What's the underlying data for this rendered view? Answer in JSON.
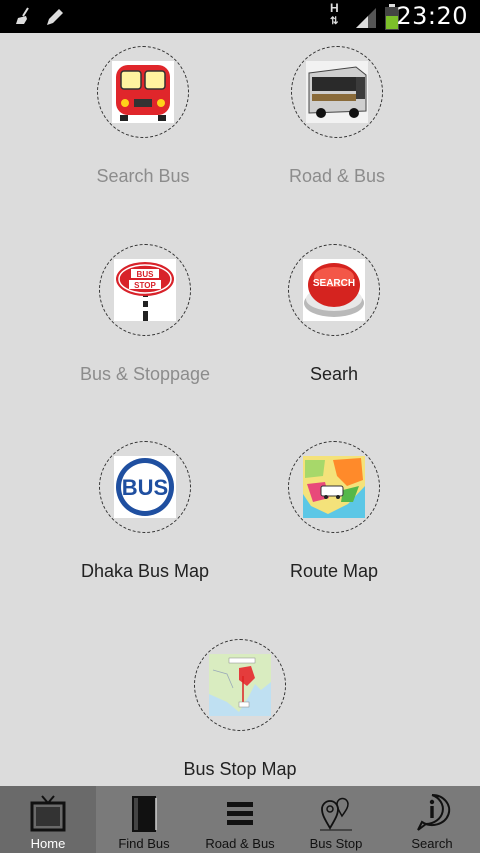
{
  "status_bar": {
    "time": "23:20",
    "network_letter": "H",
    "icons": [
      "broom-icon",
      "pencil-icon",
      "hspa-icon",
      "signal-icon",
      "battery-icon"
    ]
  },
  "tiles": [
    {
      "label": "Search Bus",
      "icon": "red-bus-icon",
      "enabled": false
    },
    {
      "label": "Road & Bus",
      "icon": "coach-bus-photo-icon",
      "enabled": false
    },
    {
      "label": "Bus & Stoppage",
      "icon": "bus-stop-sign-icon",
      "enabled": false
    },
    {
      "label": "Searh",
      "icon": "search-button-icon",
      "enabled": true
    },
    {
      "label": "Dhaka Bus Map",
      "icon": "bus-badge-icon",
      "enabled": true
    },
    {
      "label": "Route Map",
      "icon": "route-map-icon",
      "enabled": true
    },
    {
      "label": "Bus Stop Map",
      "icon": "bangladesh-map-icon",
      "enabled": true
    }
  ],
  "tabs": [
    {
      "label": "Home",
      "icon": "tv-icon",
      "active": true
    },
    {
      "label": "Find Bus",
      "icon": "book-icon",
      "active": false
    },
    {
      "label": "Road & Bus",
      "icon": "menu-lines-icon",
      "active": false
    },
    {
      "label": "Bus Stop",
      "icon": "map-pins-icon",
      "active": false
    },
    {
      "label": "Search",
      "icon": "info-icon",
      "active": false
    }
  ],
  "colors": {
    "background": "#dcdcdc",
    "tab_bar": "#7a7a7a",
    "label_disabled": "#8c8c8c",
    "label_enabled": "#222222"
  }
}
